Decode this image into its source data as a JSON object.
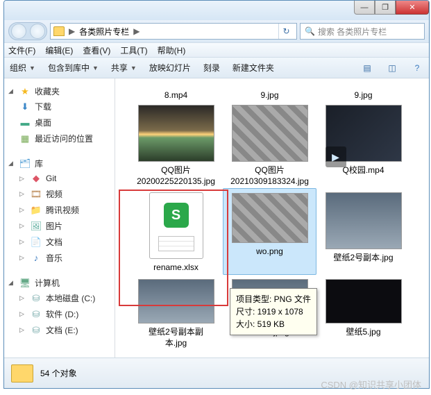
{
  "titlebar": {
    "min": "—",
    "max": "❐",
    "close": "✕"
  },
  "address": {
    "path_label": "各类照片专栏",
    "arrow": "▶",
    "refresh": "↻"
  },
  "search": {
    "placeholder": "搜索 各类照片专栏",
    "icon": "🔍"
  },
  "menubar": [
    "文件(F)",
    "编辑(E)",
    "查看(V)",
    "工具(T)",
    "帮助(H)"
  ],
  "toolbar": {
    "organize": "组织",
    "include": "包含到库中",
    "share": "共享",
    "slideshow": "放映幻灯片",
    "burn": "刻录",
    "newfolder": "新建文件夹"
  },
  "sidebar": {
    "favorites": {
      "head": "收藏夹",
      "items": [
        "下载",
        "桌面",
        "最近访问的位置"
      ]
    },
    "libraries": {
      "head": "库",
      "items": [
        "Git",
        "视频",
        "腾讯视频",
        "图片",
        "文档",
        "音乐"
      ]
    },
    "computer": {
      "head": "计算机",
      "items": [
        "本地磁盘 (C:)",
        "软件 (D:)",
        "文档 (E:)"
      ]
    }
  },
  "files": {
    "row1": [
      "8.mp4",
      "9.jpg",
      "9.jpg"
    ],
    "row2": [
      {
        "l1": "QQ图片",
        "l2": "20200225220135.jpg"
      },
      {
        "l1": "QQ图片",
        "l2": "20210309183324.jpg"
      },
      {
        "l1": "Q校园.mp4"
      }
    ],
    "row3": [
      "rename.xlsx",
      "wo.png",
      "壁纸2号副本.jpg"
    ],
    "row4": [
      {
        "l1": "壁纸2号副本副",
        "l2": "本.jpg"
      },
      {
        "l1": "壁纸3.jpeg"
      },
      {
        "l1": "壁纸5.jpg"
      }
    ]
  },
  "tooltip": {
    "l1": "项目类型: PNG 文件",
    "l2": "尺寸: 1919 x 1078",
    "l3": "大小: 519 KB"
  },
  "status": {
    "count": "54 个对象"
  },
  "watermark": "CSDN @知识共享小团体"
}
